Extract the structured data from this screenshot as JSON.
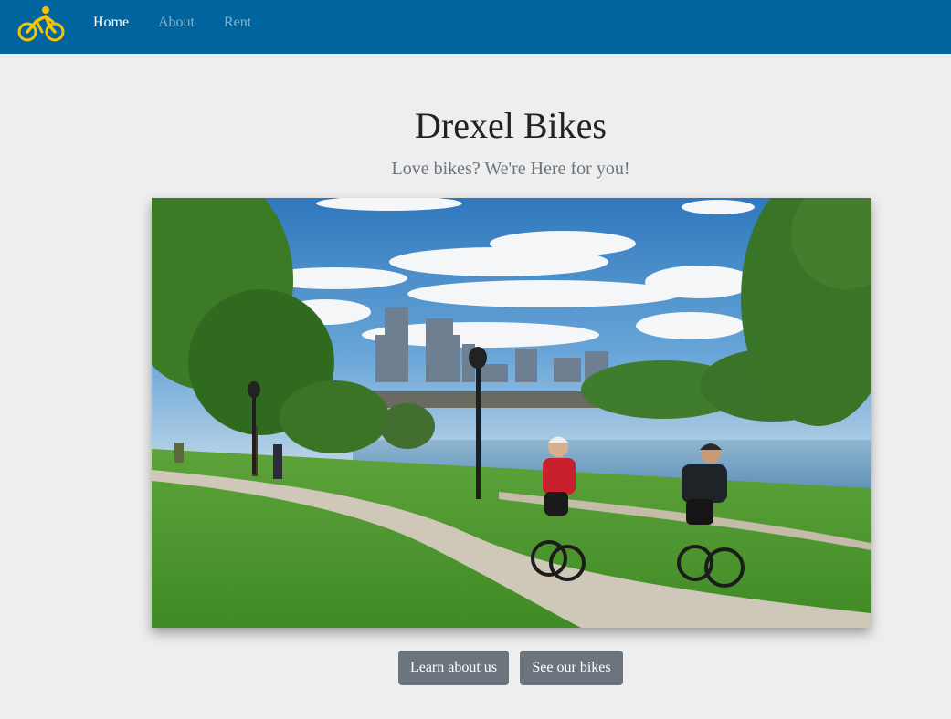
{
  "nav": {
    "logo_icon": "bicycle-rider-icon",
    "items": [
      {
        "label": "Home",
        "active": true
      },
      {
        "label": "About",
        "active": false
      },
      {
        "label": "Rent",
        "active": false
      }
    ]
  },
  "hero": {
    "title": "Drexel Bikes",
    "subtitle": "Love bikes? We're Here for you!",
    "image_subject": "cyclists-on-riverside-path-with-city-skyline"
  },
  "actions": {
    "learn_label": "Learn about us",
    "bikes_label": "See our bikes"
  },
  "colors": {
    "navbar": "#00659e",
    "logo": "#f5c400",
    "background": "#eeeeee",
    "button": "#6c757d",
    "subtitle": "#6c757d"
  }
}
